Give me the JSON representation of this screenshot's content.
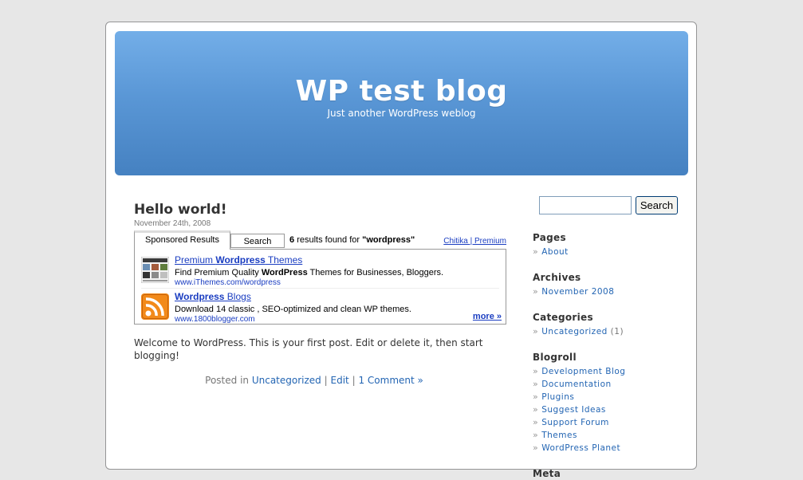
{
  "header": {
    "title": "WP test blog",
    "description": "Just another WordPress weblog"
  },
  "post": {
    "title": "Hello world!",
    "date": "November 24th, 2008",
    "body": "Welcome to WordPress. This is your first post. Edit or delete it, then start blogging!",
    "meta": {
      "posted_in": "Posted in",
      "category": "Uncategorized",
      "sep1": "|",
      "edit": "Edit",
      "sep2": "|",
      "comments": "1 Comment »"
    }
  },
  "ad": {
    "tabs": [
      "Sponsored Results",
      "Search"
    ],
    "count_num": "6",
    "count_text": "results found for",
    "query": "\"wordpress\"",
    "attribution": "Chitika | Premium",
    "more": "more »",
    "items": [
      {
        "title_pre": "Premium ",
        "title_bold": "Wordpress",
        "title_post": " Themes",
        "desc_pre": "Find Premium Quality ",
        "desc_bold": "WordPress",
        "desc_post": " Themes for Businesses, Bloggers.",
        "url": "www.iThemes.com/wordpress",
        "thumb_icon": "website-thumbnail-icon"
      },
      {
        "title_pre": "",
        "title_bold": "Wordpress",
        "title_post": " Blogs",
        "desc_pre": "Download 14 classic , SEO-optimized and clean WP themes.",
        "desc_bold": "",
        "desc_post": "",
        "url": "www.1800blogger.com",
        "thumb_icon": "rss-feed-icon"
      }
    ]
  },
  "sidebar": {
    "search_button": "Search",
    "pages": {
      "title": "Pages",
      "items": [
        "About"
      ]
    },
    "archives": {
      "title": "Archives",
      "items": [
        "November 2008"
      ]
    },
    "categories": {
      "title": "Categories",
      "items": [
        {
          "label": "Uncategorized",
          "count": "(1)"
        }
      ]
    },
    "blogroll": {
      "title": "Blogroll",
      "items": [
        "Development Blog",
        "Documentation",
        "Plugins",
        "Suggest Ideas",
        "Support Forum",
        "Themes",
        "WordPress Planet"
      ]
    },
    "meta": {
      "title": "Meta"
    }
  },
  "colors": {
    "header_top": "#73aee8",
    "header_bottom": "#4581c1",
    "link": "#2365b3",
    "ad_link": "#1a3dc1"
  }
}
